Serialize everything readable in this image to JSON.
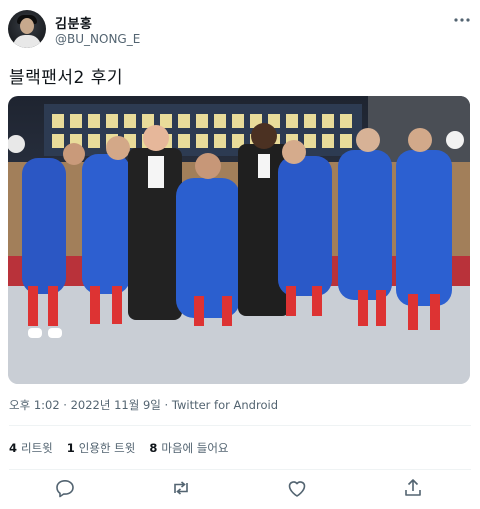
{
  "author": {
    "display_name": "김분홍",
    "handle": "@BU_NONG_E",
    "avatar_icon": "avatar-photo"
  },
  "tweet": {
    "text": "블랙팬서2 후기",
    "media_alt_icon": "group-photo",
    "time": "오후 1:02",
    "separator": "·",
    "date": "2022년 11월 9일",
    "client": "Twitter for Android"
  },
  "stats": {
    "retweets_count": "4",
    "retweets_label": "리트윗",
    "quotes_count": "1",
    "quotes_label": "인용한 트윗",
    "likes_count": "8",
    "likes_label": "마음에 들어요"
  },
  "actions": {
    "reply_icon": "reply-icon",
    "retweet_icon": "retweet-icon",
    "like_icon": "heart-icon",
    "share_icon": "share-icon"
  },
  "colors": {
    "text": "#0f1419",
    "secondary": "#536471",
    "divider": "#eff3f4"
  }
}
